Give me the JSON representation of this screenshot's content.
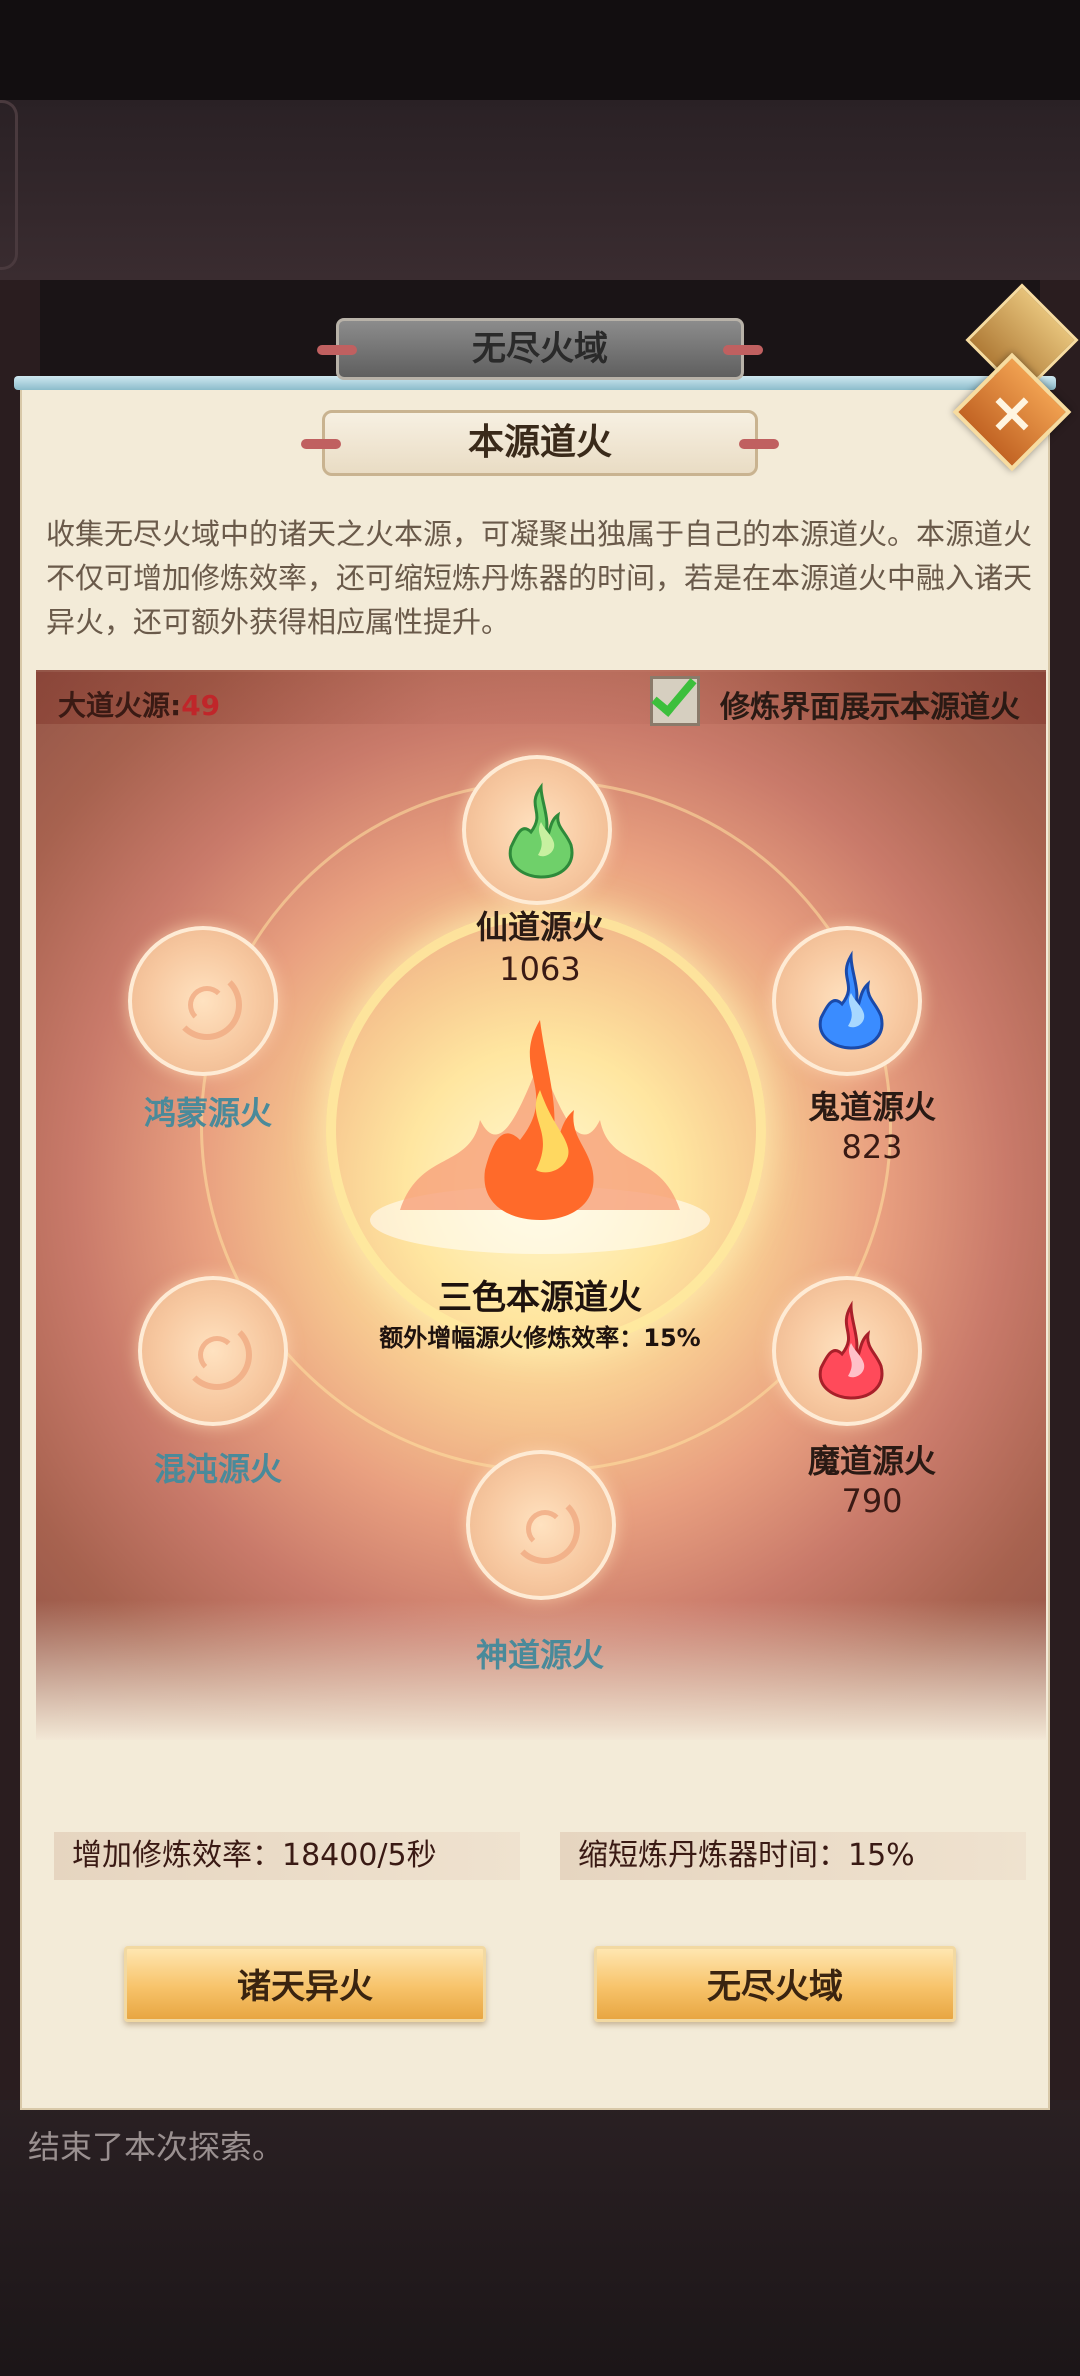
{
  "window": {
    "top_tab": "无尽火域",
    "panel_title": "本源道火",
    "description": "收集无尽火域中的诸天之火本源，可凝聚出独属于自己的本源道火。本源道火不仅可增加修炼效率，还可缩短炼丹炼器的时间，若是在本源道火中融入诸天异火，还可额外获得相应属性提升。"
  },
  "header": {
    "dao_source_label": "大道火源:",
    "dao_source_value": "49",
    "checkbox_label": "修炼界面展示本源道火",
    "checkbox_checked": true
  },
  "nodes": {
    "xiandao": {
      "label": "仙道源火",
      "value": "1063",
      "color": "#2a1a14",
      "flame_color": "#6fd06a"
    },
    "guidao": {
      "label": "鬼道源火",
      "value": "823",
      "color": "#2a1a14",
      "flame_color": "#3a8cff"
    },
    "modao": {
      "label": "魔道源火",
      "value": "790",
      "color": "#2a1a14",
      "flame_color": "#ff4a5a"
    },
    "hongmeng": {
      "label": "鸿蒙源火",
      "color": "#4a8a9a"
    },
    "hundun": {
      "label": "混沌源火",
      "color": "#4a8a9a"
    },
    "shendao": {
      "label": "神道源火",
      "color": "#4a8a9a"
    }
  },
  "center": {
    "title": "三色本源道火",
    "subtitle": "额外增幅源火修炼效率：15%"
  },
  "stats": {
    "left": "增加修炼效率：18400/5秒",
    "right": "缩短炼丹炼器时间：15%"
  },
  "buttons": {
    "left": "诸天异火",
    "right": "无尽火域"
  },
  "log": {
    "last_message": "结束了本次探索。"
  },
  "icons": {
    "close": "close-icon",
    "back": "back-arrow-icon"
  }
}
